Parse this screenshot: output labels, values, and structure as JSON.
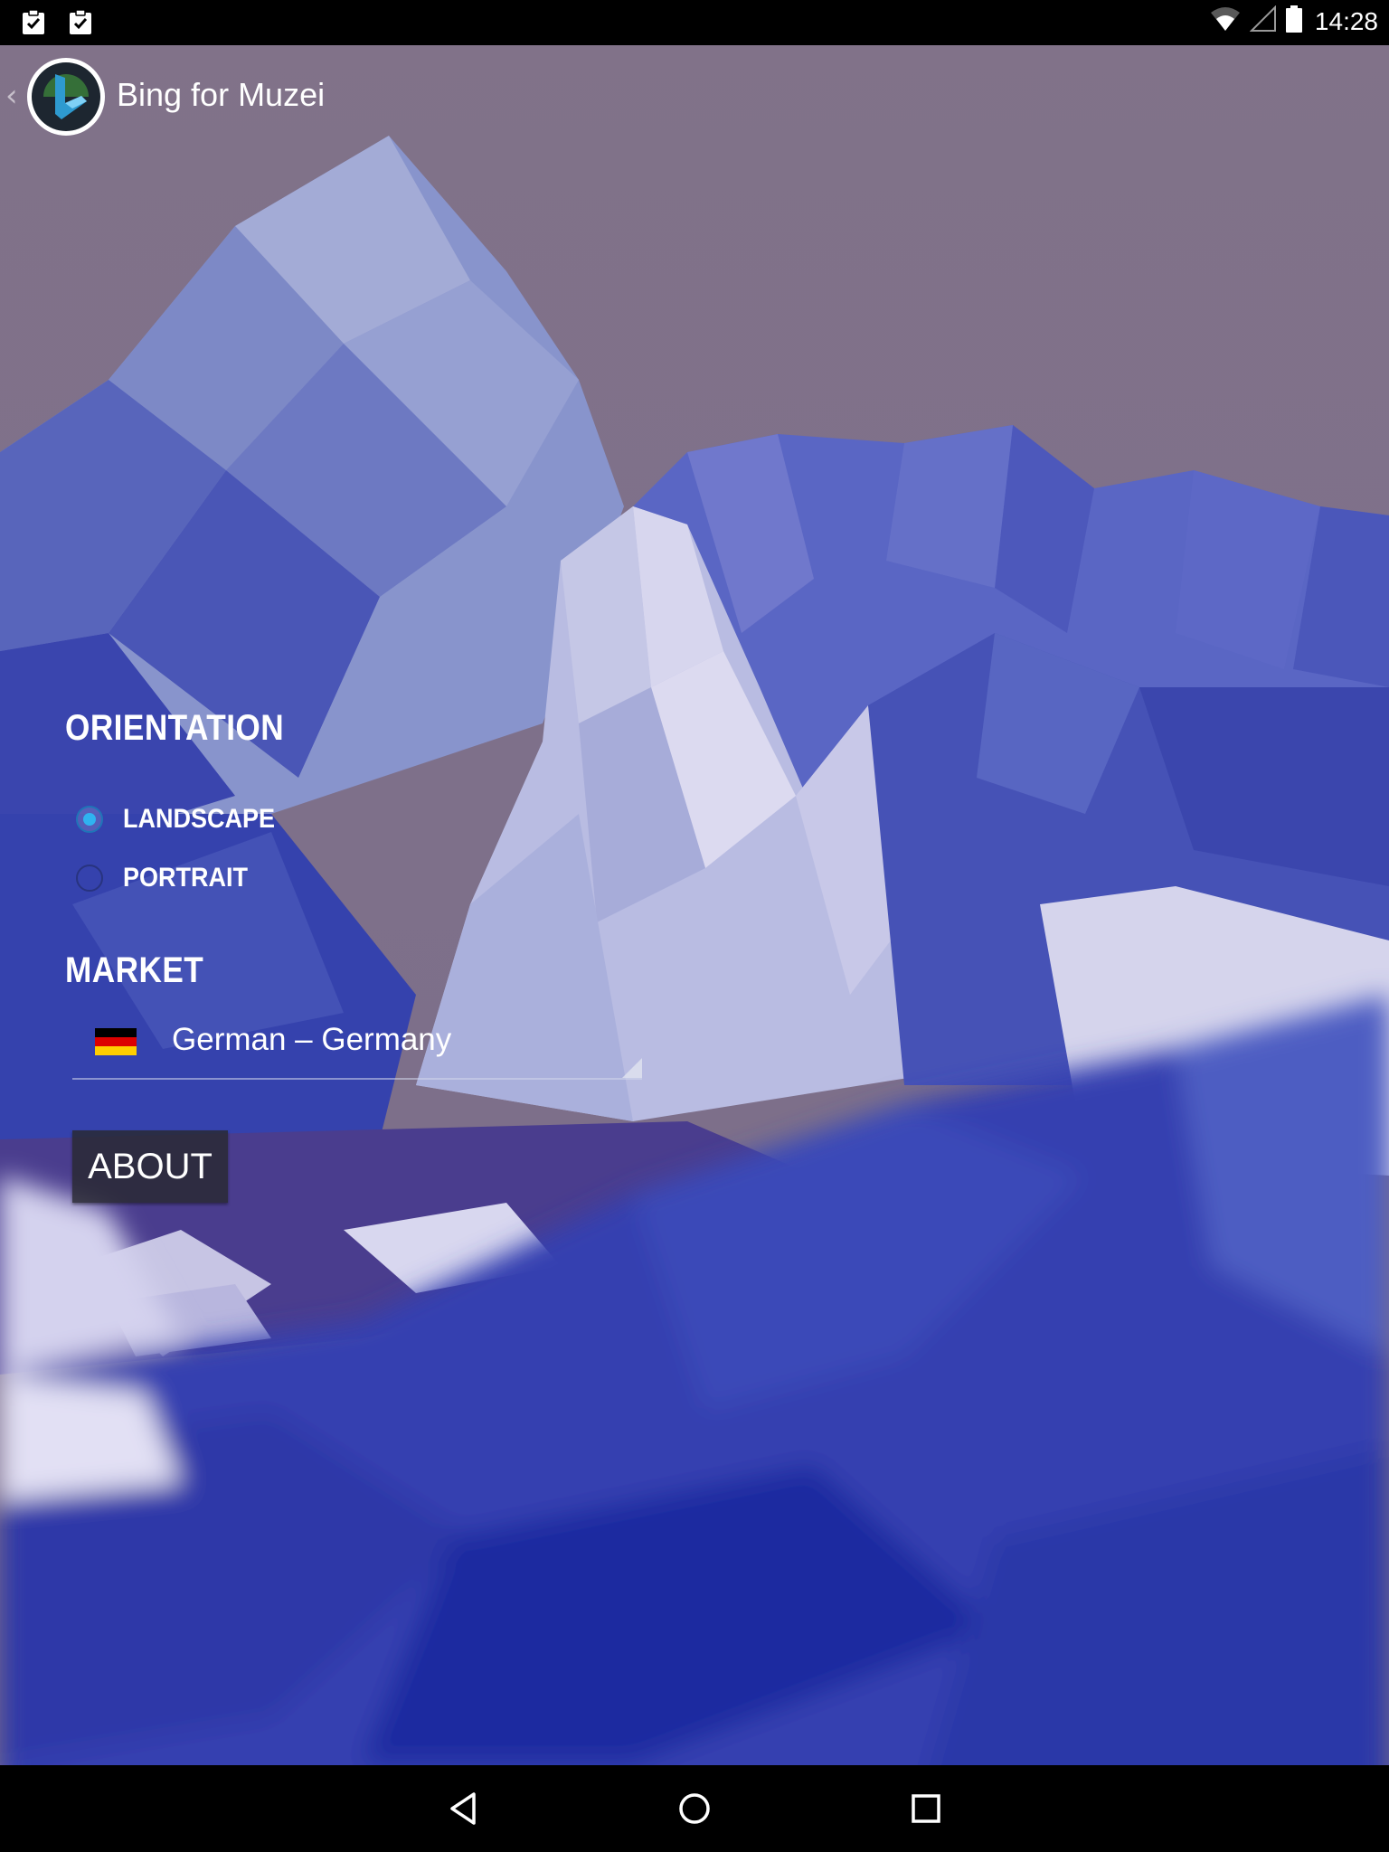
{
  "status_bar": {
    "time": "14:28",
    "icons": [
      "clipboard-check-icon",
      "clipboard-check-icon",
      "wifi-icon",
      "cell-signal-icon",
      "battery-icon"
    ]
  },
  "action_bar": {
    "title": "Bing for Muzei",
    "icon": "bing-app-icon",
    "up_icon": "up-caret-icon"
  },
  "orientation": {
    "header": "ORIENTATION",
    "options": [
      {
        "label": "LANDSCAPE",
        "selected": true
      },
      {
        "label": "PORTRAIT",
        "selected": false
      }
    ]
  },
  "market": {
    "header": "MARKET",
    "selected": "German – Germany",
    "flag_icon": "germany-flag-icon",
    "flag_colors": [
      "#000000",
      "#dd0000",
      "#ffce00"
    ]
  },
  "about": {
    "label": "ABOUT"
  },
  "nav_bar": {
    "icons": [
      "back-icon",
      "home-icon",
      "recents-icon"
    ]
  },
  "colors": {
    "radio_accent": "#2fb3f0",
    "status_bar": "#000000",
    "nav_bar": "#000000"
  }
}
